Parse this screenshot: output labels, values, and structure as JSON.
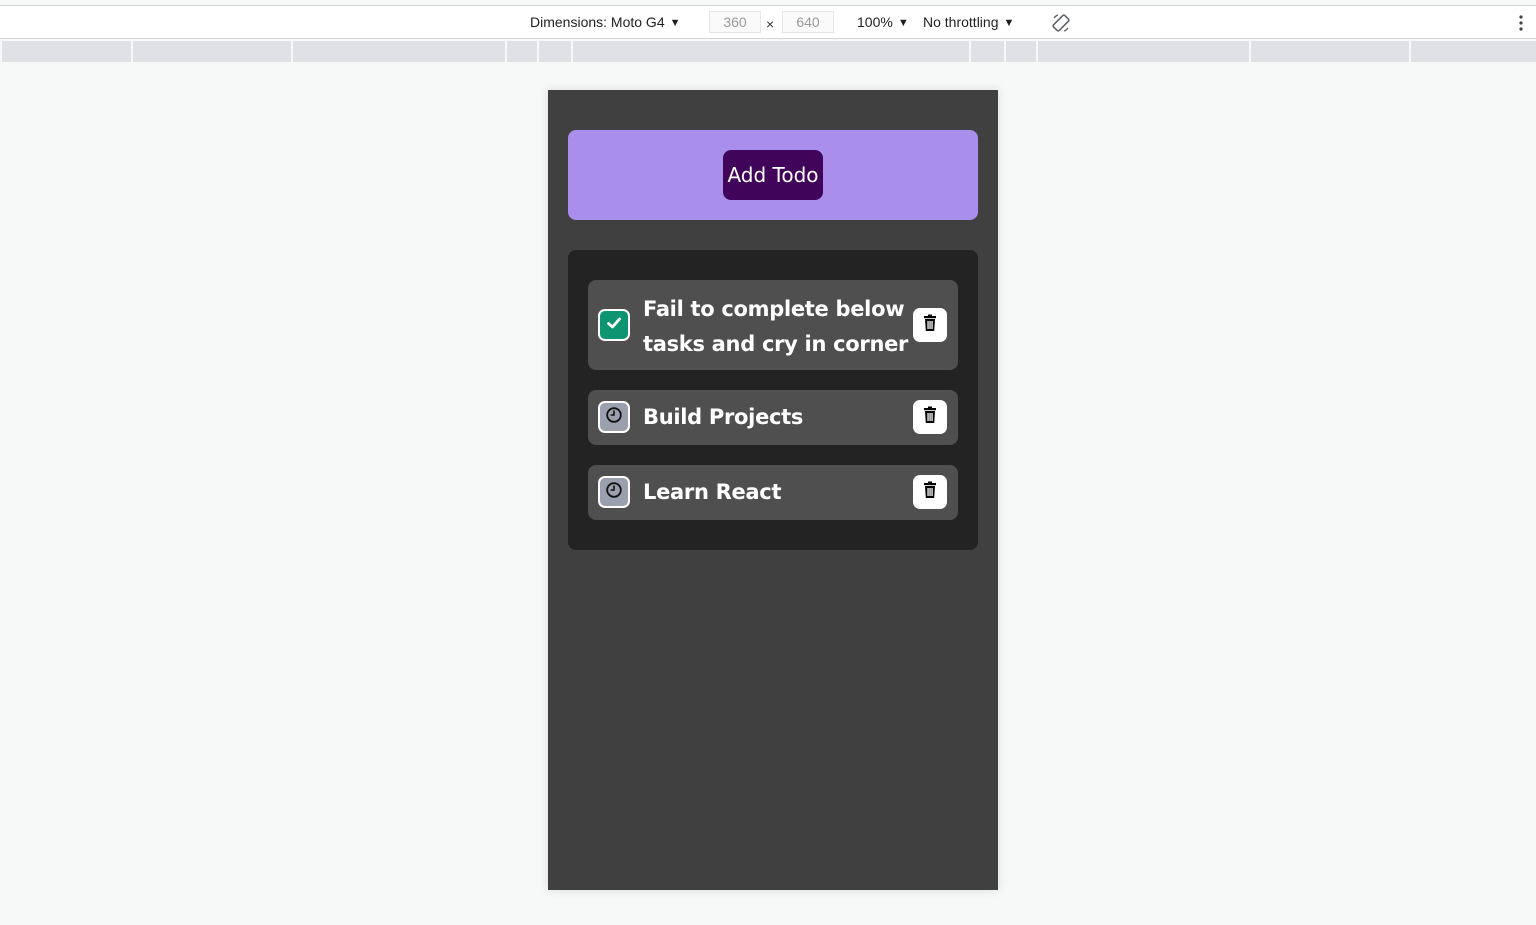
{
  "devtools": {
    "dimensions_label": "Dimensions: Moto G4",
    "width_value": "360",
    "height_value": "640",
    "times_symbol": "×",
    "zoom_label": "100%",
    "throttling_label": "No throttling",
    "icons": {
      "rotate": "rotate-icon",
      "more": "more-options-icon",
      "caret": "caret-down-icon"
    }
  },
  "app": {
    "add_button_label": "Add Todo",
    "todos": [
      {
        "text_line1": "Fail to complete below",
        "text_line2": "tasks and cry in corner",
        "status": "completed",
        "status_icon": "check-icon",
        "delete_icon": "trash-icon"
      },
      {
        "text": "Build Projects",
        "status": "pending",
        "status_icon": "clock-icon",
        "delete_icon": "trash-icon"
      },
      {
        "text": "Learn React",
        "status": "pending",
        "status_icon": "clock-icon",
        "delete_icon": "trash-icon"
      }
    ],
    "colors": {
      "viewport_bg": "#404040",
      "add_panel": "#a98eec",
      "add_button": "#40045a",
      "list_panel": "#232323",
      "todo_item": "#4f4f4f",
      "completed": "#0e9470",
      "pending": "#9aa0ad"
    }
  }
}
